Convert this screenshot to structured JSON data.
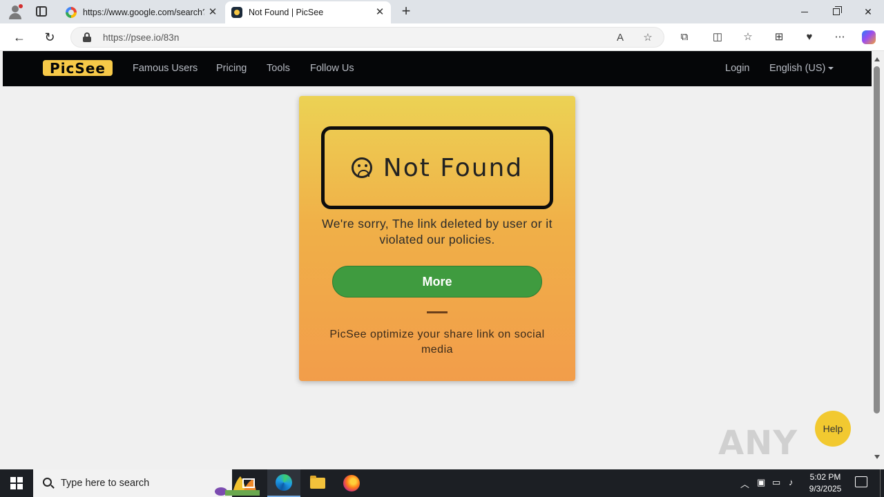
{
  "browser": {
    "tabs": [
      {
        "title": "https://www.google.com/search?q",
        "icon": "google-icon",
        "active": false
      },
      {
        "title": "Not Found | PicSee",
        "icon": "picsee-icon",
        "active": true
      }
    ],
    "address": "https://psee.io/83n"
  },
  "site": {
    "logo_text": "PicSee",
    "nav": {
      "famous_users": "Famous Users",
      "pricing": "Pricing",
      "tools": "Tools",
      "follow_us": "Follow Us",
      "login": "Login",
      "language": "English (US)"
    }
  },
  "card": {
    "title": "Not Found",
    "message": "We're sorry, The link deleted by user or it violated our policies.",
    "button_label": "More",
    "tagline": "PicSee optimize your share link on social media"
  },
  "help": {
    "label": "Help"
  },
  "watermark": "ANY RUN",
  "taskbar": {
    "search_placeholder": "Type here to search",
    "time": "5:02 PM",
    "date": "9/3/2025"
  },
  "colors": {
    "site_nav_bg": "#050608",
    "logo_yellow": "#f7c948",
    "card_top": "#ecd254",
    "card_bottom": "#f29d4a",
    "button_green": "#3f9b3f",
    "help_yellow": "#f2c930"
  }
}
